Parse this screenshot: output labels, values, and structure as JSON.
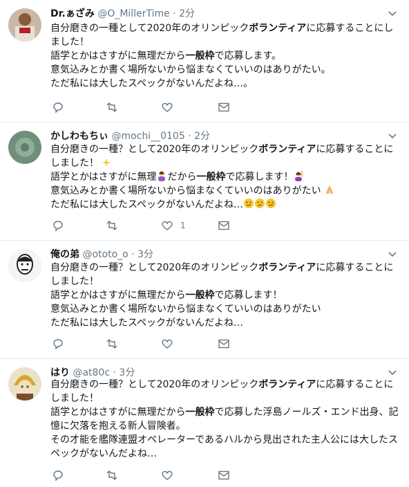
{
  "tweets": [
    {
      "name": "Dr.ぁざみ",
      "handle": "@O_MillerTime",
      "dot": "·",
      "time": "2分",
      "lines": [
        [
          "自分磨きの一種として2020年のオリンピック",
          "ボランティア",
          "に応募することにし"
        ],
        [
          "ました！",
          "",
          ""
        ],
        [
          "語学とかはさすがに無理だから",
          "一般枠",
          "で応募します。"
        ],
        [
          "意気込みとか書く場所ないから悩まなくていいのはありがたい。",
          "",
          ""
        ],
        [
          "ただ私には大したスペックがないんだよね…。",
          "",
          ""
        ]
      ],
      "like_count": ""
    },
    {
      "name": "かしわもちぃ",
      "handle": "@mochi__0105",
      "dot": "·",
      "time": "2分",
      "lines": [
        [
          "自分磨きの一種？として2020年のオリンピック",
          "ボランティア",
          "に応募することに"
        ],
        [
          "しました！",
          "",
          ""
        ],
        [
          "語学とかはさすがに無理",
          "",
          "だから"
        ],
        [
          "意気込みとか書く場所ないから悩まなくていいのはありがたい",
          "",
          ""
        ],
        [
          "ただ私には大したスペックがないんだよね…",
          "",
          ""
        ]
      ],
      "line3_part2": "一般枠",
      "line3_part3": "で応募します！",
      "like_count": "1"
    },
    {
      "name": "俺の弟",
      "handle": "@ototo_o",
      "dot": "·",
      "time": "3分",
      "lines": [
        [
          "自分磨きの一種？として2020年のオリンピック",
          "ボランティア",
          "に応募することに"
        ],
        [
          "しました！",
          "",
          ""
        ],
        [
          "語学とかはさすがに無理だから",
          "一般枠",
          "で応募します！"
        ],
        [
          "意気込みとか書く場所ないから悩まなくていいのはありがたい",
          "",
          ""
        ],
        [
          "ただ私には大したスペックがないんだよね…",
          "",
          ""
        ]
      ],
      "like_count": ""
    },
    {
      "name": "はり",
      "handle": "@at80c",
      "dot": "·",
      "time": "3分",
      "lines": [
        [
          "自分磨きの一種？として2020年のオリンピック",
          "ボランティア",
          "に応募することに"
        ],
        [
          "しました！",
          "",
          ""
        ],
        [
          "語学とかはさすがに無理だから",
          "一般枠",
          "で応募した浮島ノールズ・エンド出身、記"
        ],
        [
          "憶に欠落を抱える新人冒険者。",
          "",
          ""
        ],
        [
          "その才能を艦隊連盟オペレーターであるハルから見出された主人公には大したス",
          "",
          ""
        ],
        [
          "ペックがないんだよね…",
          "",
          ""
        ]
      ],
      "like_count": ""
    }
  ],
  "icons": {
    "reply": "reply-icon",
    "retweet": "retweet-icon",
    "like": "heart-icon",
    "dm": "envelope-icon",
    "caret": "chevron-down-icon"
  },
  "colors": {
    "icon": "#657786",
    "border": "#e6ecf0",
    "text": "#14171a"
  }
}
